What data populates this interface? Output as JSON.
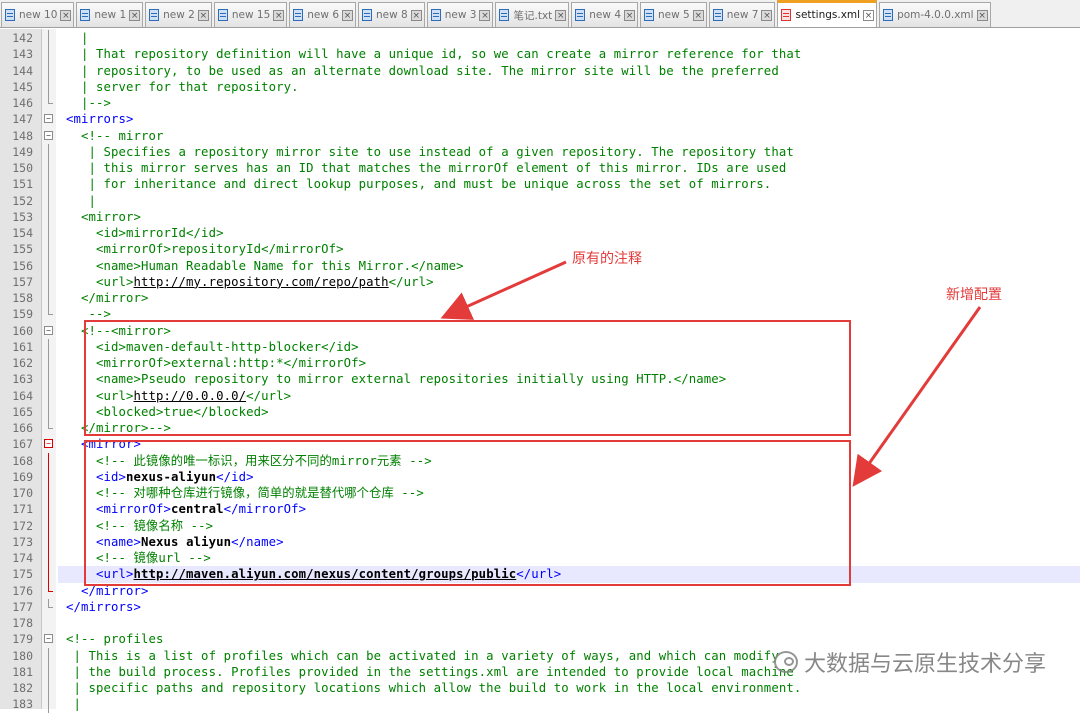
{
  "tabs": [
    {
      "label": "new 10",
      "active": false,
      "icon": "file-icon"
    },
    {
      "label": "new 1",
      "active": false,
      "icon": "file-icon"
    },
    {
      "label": "new 2",
      "active": false,
      "icon": "file-icon"
    },
    {
      "label": "new 15",
      "active": false,
      "icon": "file-icon"
    },
    {
      "label": "new 6",
      "active": false,
      "icon": "file-icon"
    },
    {
      "label": "new 8",
      "active": false,
      "icon": "file-icon"
    },
    {
      "label": "new 3",
      "active": false,
      "icon": "file-icon"
    },
    {
      "label": "笔记.txt",
      "active": false,
      "icon": "file-icon"
    },
    {
      "label": "new 4",
      "active": false,
      "icon": "file-icon"
    },
    {
      "label": "new 5",
      "active": false,
      "icon": "file-icon"
    },
    {
      "label": "new 7",
      "active": false,
      "icon": "file-icon"
    },
    {
      "label": "settings.xml",
      "active": true,
      "icon": "file-modified-icon"
    },
    {
      "label": "pom-4.0.0.xml",
      "active": false,
      "icon": "file-icon"
    }
  ],
  "tab_close_glyph": "×",
  "colors": {
    "accent": "#e33a3a",
    "comment": "#008000",
    "tag": "#0000ff",
    "active_tab_marker": "#f0a020",
    "current_line": "#e8e8ff"
  },
  "editor": {
    "current_line": 175,
    "lines": [
      {
        "n": 142,
        "fold": "bar",
        "seg": [
          [
            "cm",
            "  |"
          ]
        ]
      },
      {
        "n": 143,
        "fold": "bar",
        "seg": [
          [
            "cm",
            "  | That repository definition will have a unique id, so we can create a mirror reference for that"
          ]
        ]
      },
      {
        "n": 144,
        "fold": "bar",
        "seg": [
          [
            "cm",
            "  | repository, to be used as an alternate download site. The mirror site will be the preferred"
          ]
        ]
      },
      {
        "n": 145,
        "fold": "bar",
        "seg": [
          [
            "cm",
            "  | server for that repository."
          ]
        ]
      },
      {
        "n": 146,
        "fold": "end",
        "seg": [
          [
            "cm",
            "  |-->"
          ]
        ]
      },
      {
        "n": 147,
        "fold": "minus",
        "seg": [
          [
            "tg",
            "<mirrors>"
          ]
        ]
      },
      {
        "n": 148,
        "fold": "minus",
        "seg": [
          [
            "cm",
            "  <!-- mirror"
          ]
        ]
      },
      {
        "n": 149,
        "fold": "bar",
        "seg": [
          [
            "cm",
            "   | Specifies a repository mirror site to use instead of a given repository. The repository that"
          ]
        ]
      },
      {
        "n": 150,
        "fold": "bar",
        "seg": [
          [
            "cm",
            "   | this mirror serves has an ID that matches the mirrorOf element of this mirror. IDs are used"
          ]
        ]
      },
      {
        "n": 151,
        "fold": "bar",
        "seg": [
          [
            "cm",
            "   | for inheritance and direct lookup purposes, and must be unique across the set of mirrors."
          ]
        ]
      },
      {
        "n": 152,
        "fold": "bar",
        "seg": [
          [
            "cm",
            "   |"
          ]
        ]
      },
      {
        "n": 153,
        "fold": "bar",
        "seg": [
          [
            "cm",
            "  <mirror>"
          ]
        ]
      },
      {
        "n": 154,
        "fold": "bar",
        "seg": [
          [
            "cm",
            "    <id>mirrorId</id>"
          ]
        ]
      },
      {
        "n": 155,
        "fold": "bar",
        "seg": [
          [
            "cm",
            "    <mirrorOf>repositoryId</mirrorOf>"
          ]
        ]
      },
      {
        "n": 156,
        "fold": "bar",
        "seg": [
          [
            "cm",
            "    <name>Human Readable Name for this Mirror.</name>"
          ]
        ]
      },
      {
        "n": 157,
        "fold": "bar",
        "seg": [
          [
            "cm",
            "    <url>"
          ],
          [
            "ln",
            "http://my.repository.com/repo/path"
          ],
          [
            "cm",
            "</url>"
          ]
        ]
      },
      {
        "n": 158,
        "fold": "bar",
        "seg": [
          [
            "cm",
            "  </mirror>"
          ]
        ]
      },
      {
        "n": 159,
        "fold": "end",
        "seg": [
          [
            "cm",
            "   -->"
          ]
        ]
      },
      {
        "n": 160,
        "fold": "minus",
        "seg": [
          [
            "cm",
            "  <!--<mirror>"
          ]
        ]
      },
      {
        "n": 161,
        "fold": "bar",
        "seg": [
          [
            "cm",
            "    <id>maven-default-http-blocker</id>"
          ]
        ]
      },
      {
        "n": 162,
        "fold": "bar",
        "seg": [
          [
            "cm",
            "    <mirrorOf>external:http:*</mirrorOf>"
          ]
        ]
      },
      {
        "n": 163,
        "fold": "bar",
        "seg": [
          [
            "cm",
            "    <name>Pseudo repository to mirror external repositories initially using HTTP.</name>"
          ]
        ]
      },
      {
        "n": 164,
        "fold": "bar",
        "seg": [
          [
            "cm",
            "    <url>"
          ],
          [
            "ln",
            "http://0.0.0.0/"
          ],
          [
            "cm",
            "</url>"
          ]
        ]
      },
      {
        "n": 165,
        "fold": "bar",
        "seg": [
          [
            "cm",
            "    <blocked>true</blocked>"
          ]
        ]
      },
      {
        "n": 166,
        "fold": "end",
        "seg": [
          [
            "cm",
            "  </mirror>-->"
          ]
        ]
      },
      {
        "n": 167,
        "fold": "minus-red",
        "seg": [
          [
            "tg",
            "  <mirror>"
          ]
        ]
      },
      {
        "n": 168,
        "fold": "bar-red",
        "seg": [
          [
            "cm",
            "    <!-- 此镜像的唯一标识，用来区分不同的mirror元素 -->"
          ]
        ]
      },
      {
        "n": 169,
        "fold": "bar-red",
        "seg": [
          [
            "tg",
            "    <id>"
          ],
          [
            "tx",
            "nexus-aliyun"
          ],
          [
            "tg",
            "</id>"
          ]
        ]
      },
      {
        "n": 170,
        "fold": "bar-red",
        "seg": [
          [
            "cm",
            "    <!-- 对哪种仓库进行镜像，简单的就是替代哪个仓库 -->"
          ]
        ]
      },
      {
        "n": 171,
        "fold": "bar-red",
        "seg": [
          [
            "tg",
            "    <mirrorOf>"
          ],
          [
            "tx",
            "central"
          ],
          [
            "tg",
            "</mirrorOf>"
          ]
        ]
      },
      {
        "n": 172,
        "fold": "bar-red",
        "seg": [
          [
            "cm",
            "    <!-- 镜像名称 -->"
          ]
        ]
      },
      {
        "n": 173,
        "fold": "bar-red",
        "seg": [
          [
            "tg",
            "    <name>"
          ],
          [
            "tx",
            "Nexus aliyun"
          ],
          [
            "tg",
            "</name>"
          ]
        ]
      },
      {
        "n": 174,
        "fold": "bar-red",
        "seg": [
          [
            "cm",
            "    <!-- 镜像url -->"
          ]
        ]
      },
      {
        "n": 175,
        "fold": "bar-red",
        "seg": [
          [
            "tg",
            "    <url>"
          ],
          [
            "lnb",
            "http://maven.aliyun.com/nexus/content/groups/public"
          ],
          [
            "tg",
            "</url>"
          ]
        ]
      },
      {
        "n": 176,
        "fold": "end-red",
        "seg": [
          [
            "tg",
            "  </mirror>"
          ]
        ]
      },
      {
        "n": 177,
        "fold": "end",
        "seg": [
          [
            "tg",
            "</mirrors>"
          ]
        ]
      },
      {
        "n": 178,
        "fold": "none",
        "seg": []
      },
      {
        "n": 179,
        "fold": "minus",
        "seg": [
          [
            "cm",
            "<!-- profiles"
          ]
        ]
      },
      {
        "n": 180,
        "fold": "bar",
        "seg": [
          [
            "cm",
            " | This is a list of profiles which can be activated in a variety of ways, and which can modify"
          ]
        ]
      },
      {
        "n": 181,
        "fold": "bar",
        "seg": [
          [
            "cm",
            " | the build process. Profiles provided in the settings.xml are intended to provide local machine"
          ]
        ]
      },
      {
        "n": 182,
        "fold": "bar",
        "seg": [
          [
            "cm",
            " | specific paths and repository locations which allow the build to work in the local environment."
          ]
        ]
      },
      {
        "n": 183,
        "fold": "bar",
        "seg": [
          [
            "cm",
            " |"
          ]
        ]
      }
    ]
  },
  "annotations": {
    "original_comment_label": "原有的注释",
    "new_config_label": "新增配置"
  },
  "watermark": {
    "text": "大数据与云原生技术分享"
  }
}
